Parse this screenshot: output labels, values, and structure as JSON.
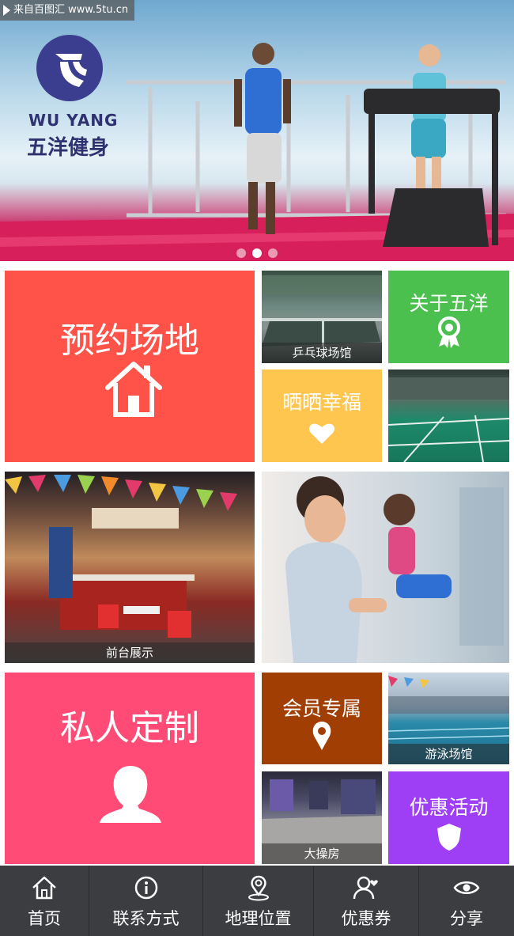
{
  "watermark": {
    "text": "来自百图汇 www.5tu.cn"
  },
  "banner": {
    "logo_en": "WU YANG",
    "logo_cn": "五洋健身",
    "slides": 3,
    "active_slide": 2
  },
  "tiles": {
    "book_venue": {
      "label": "预约场地",
      "icon": "home-icon",
      "color": "#ff5349"
    },
    "table_tennis": {
      "caption": "乒乓球场馆"
    },
    "about": {
      "label": "关于五洋",
      "icon": "award-ribbon-icon",
      "color": "#4cc04f"
    },
    "share_happiness": {
      "label": "晒晒幸福",
      "icon": "heart-icon",
      "color": "#fec64f"
    },
    "badminton": {
      "caption": ""
    },
    "front_desk": {
      "caption": "前台展示"
    },
    "gym_photo": {
      "caption": ""
    },
    "custom": {
      "label": "私人定制",
      "icon": "person-icon",
      "color": "#ff4b76"
    },
    "member": {
      "label": "会员专属",
      "icon": "location-pin-icon",
      "color": "#a03e04"
    },
    "swimming": {
      "caption": "游泳场馆"
    },
    "hall": {
      "caption": "大操房"
    },
    "promotion": {
      "label": "优惠活动",
      "icon": "shield-icon",
      "color": "#9e3ff6"
    }
  },
  "nav": [
    {
      "label": "首页",
      "icon": "home-icon"
    },
    {
      "label": "联系方式",
      "icon": "info-icon"
    },
    {
      "label": "地理位置",
      "icon": "map-pin-icon"
    },
    {
      "label": "优惠券",
      "icon": "user-heart-icon"
    },
    {
      "label": "分享",
      "icon": "eye-icon"
    }
  ],
  "colors": {
    "nav_bg": "#3b3d41"
  }
}
